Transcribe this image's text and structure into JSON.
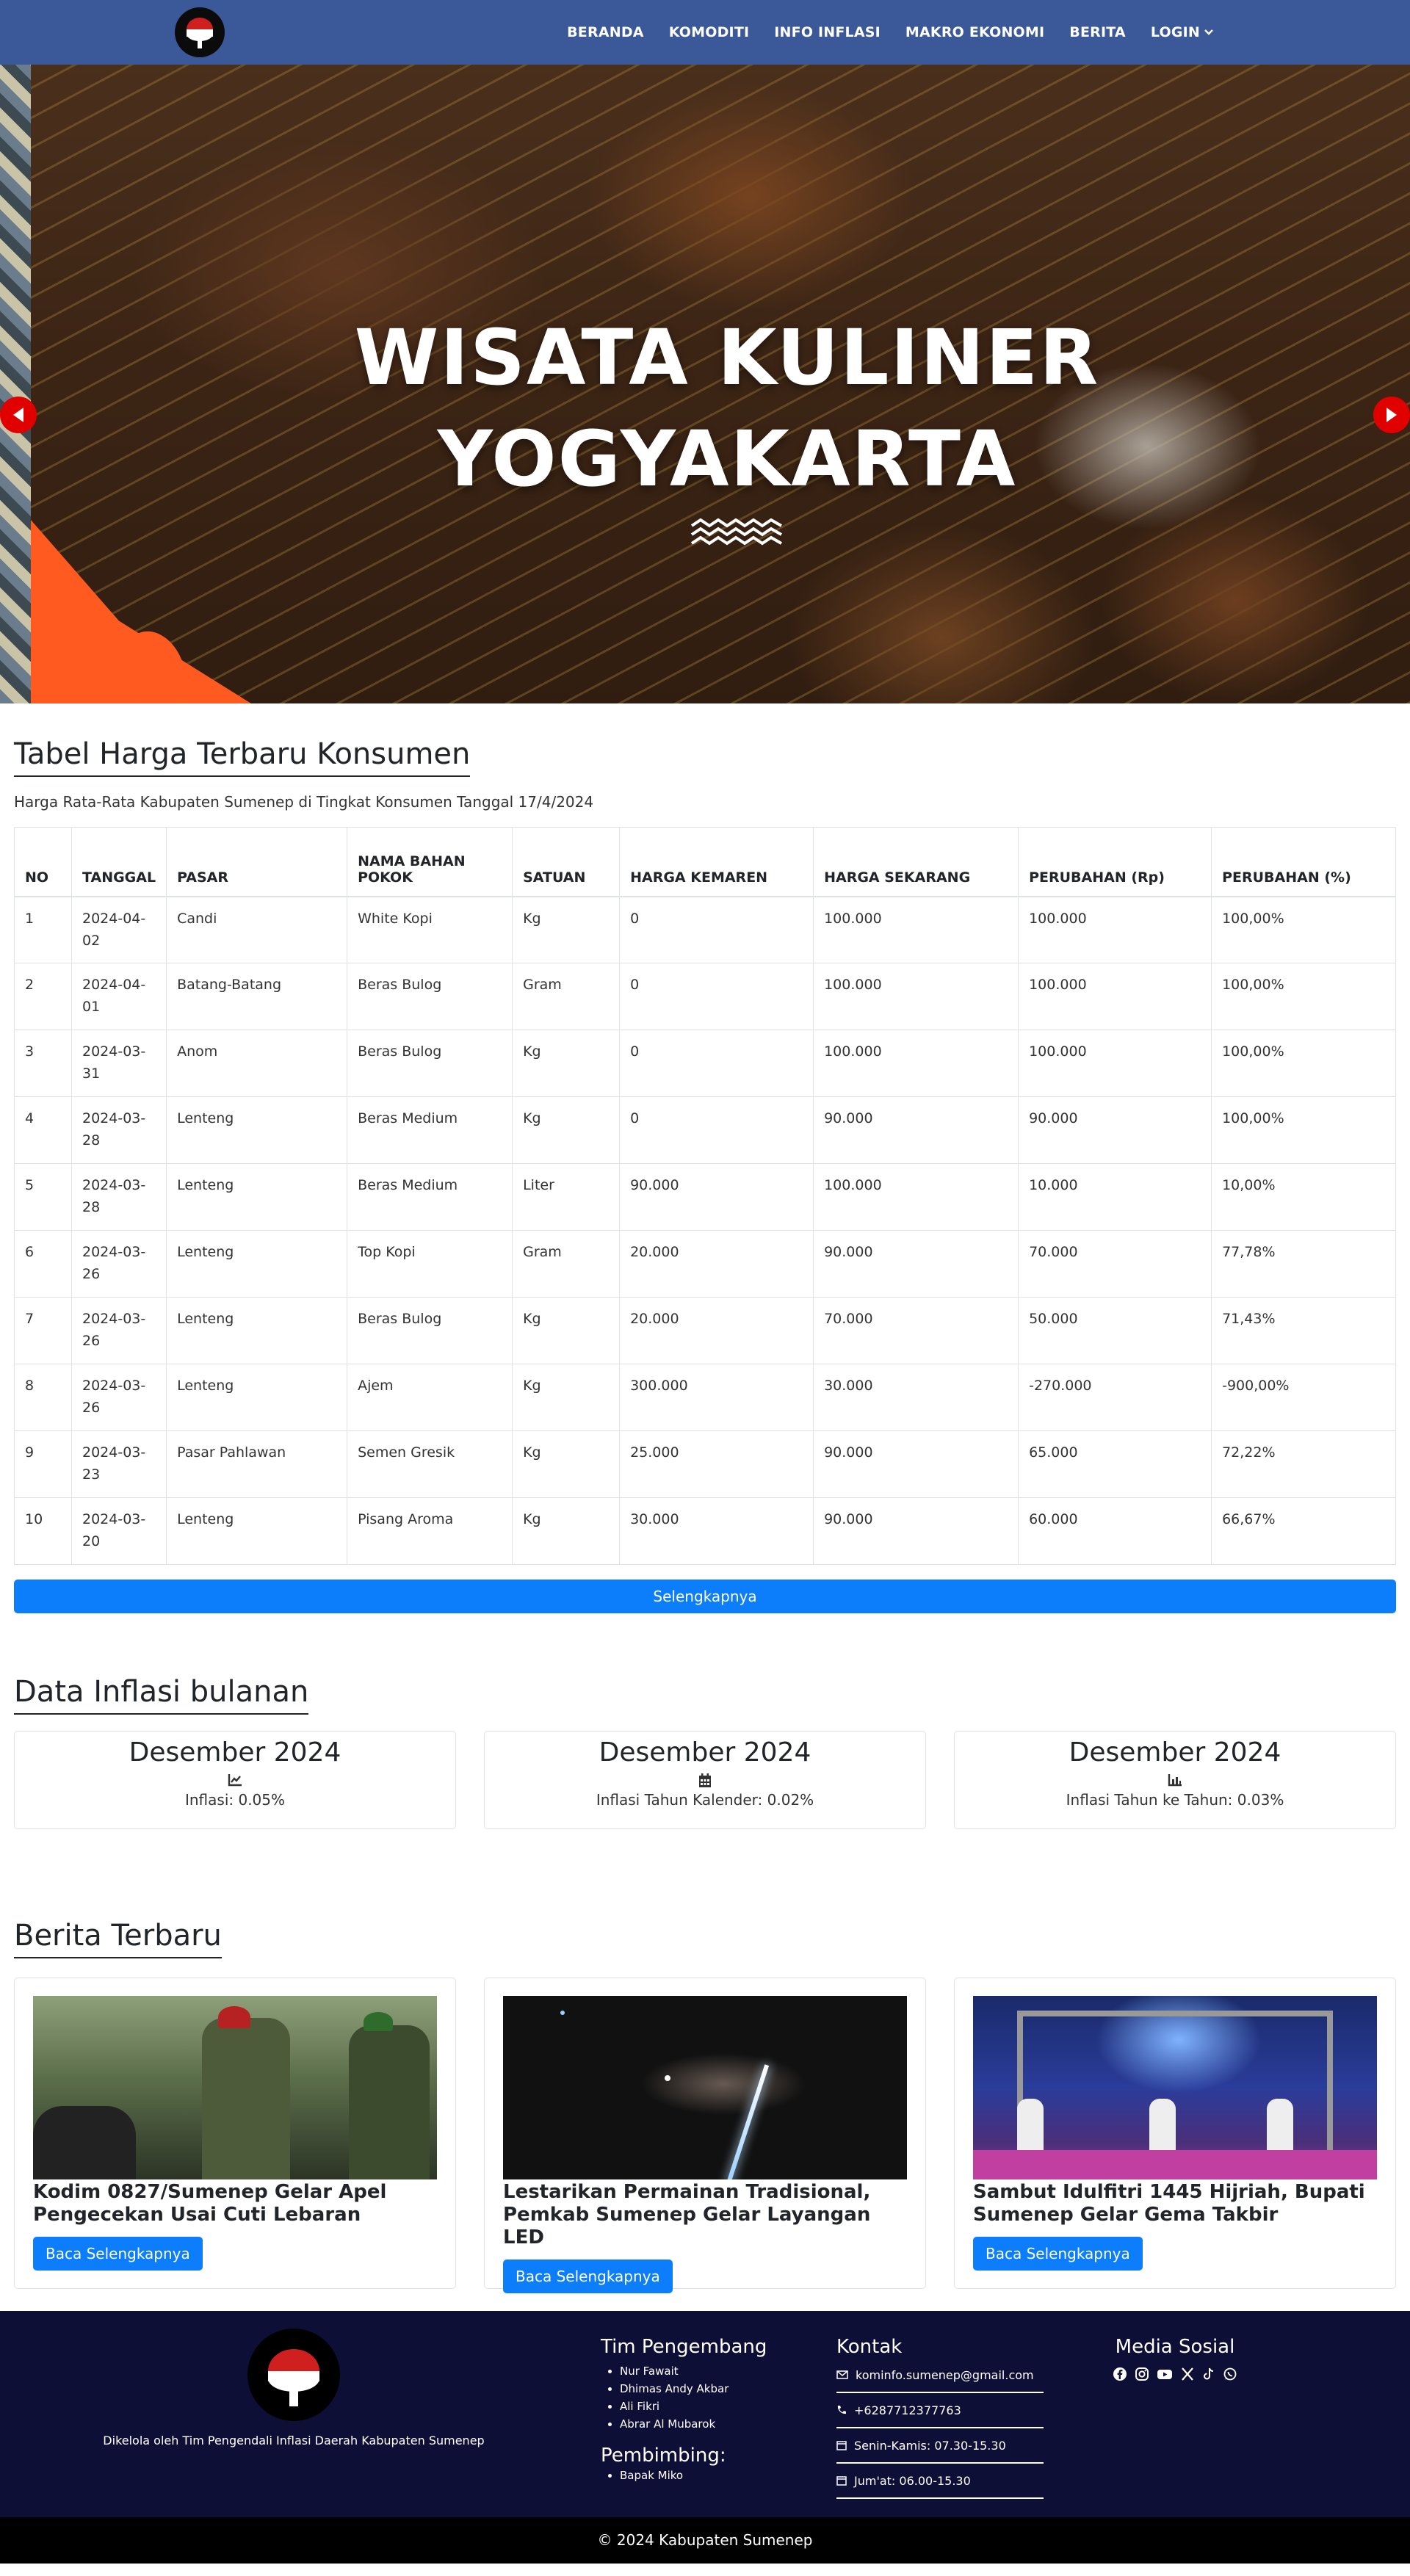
{
  "nav": {
    "items": [
      "BERANDA",
      "KOMODITI",
      "INFO INFLASI",
      "MAKRO EKONOMI",
      "BERITA",
      "LOGIN"
    ]
  },
  "hero": {
    "line1": "WISATA KULINER",
    "line2": "YOGYAKARTA"
  },
  "price_table": {
    "title": "Tabel Harga Terbaru Konsumen",
    "subtitle": "Harga Rata-Rata Kabupaten Sumenep di Tingkat Konsumen Tanggal 17/4/2024",
    "headers": [
      "NO",
      "TANGGAL",
      "PASAR",
      "NAMA BAHAN POKOK",
      "SATUAN",
      "HARGA KEMAREN",
      "HARGA SEKARANG",
      "PERUBAHAN (Rp)",
      "PERUBAHAN (%)"
    ],
    "rows": [
      [
        "1",
        "2024-04-02",
        "Candi",
        "White Kopi",
        "Kg",
        "0",
        "100.000",
        "100.000",
        "100,00%"
      ],
      [
        "2",
        "2024-04-01",
        "Batang-Batang",
        "Beras Bulog",
        "Gram",
        "0",
        "100.000",
        "100.000",
        "100,00%"
      ],
      [
        "3",
        "2024-03-31",
        "Anom",
        "Beras Bulog",
        "Kg",
        "0",
        "100.000",
        "100.000",
        "100,00%"
      ],
      [
        "4",
        "2024-03-28",
        "Lenteng",
        "Beras Medium",
        "Kg",
        "0",
        "90.000",
        "90.000",
        "100,00%"
      ],
      [
        "5",
        "2024-03-28",
        "Lenteng",
        "Beras Medium",
        "Liter",
        "90.000",
        "100.000",
        "10.000",
        "10,00%"
      ],
      [
        "6",
        "2024-03-26",
        "Lenteng",
        "Top Kopi",
        "Gram",
        "20.000",
        "90.000",
        "70.000",
        "77,78%"
      ],
      [
        "7",
        "2024-03-26",
        "Lenteng",
        "Beras Bulog",
        "Kg",
        "20.000",
        "70.000",
        "50.000",
        "71,43%"
      ],
      [
        "8",
        "2024-03-26",
        "Lenteng",
        "Ajem",
        "Kg",
        "300.000",
        "30.000",
        "-270.000",
        "-900,00%"
      ],
      [
        "9",
        "2024-03-23",
        "Pasar Pahlawan",
        "Semen Gresik",
        "Kg",
        "25.000",
        "90.000",
        "65.000",
        "72,22%"
      ],
      [
        "10",
        "2024-03-20",
        "Lenteng",
        "Pisang Aroma",
        "Kg",
        "30.000",
        "90.000",
        "60.000",
        "66,67%"
      ]
    ],
    "more_label": "Selengkapnya"
  },
  "inflasi": {
    "title": "Data Inflasi bulanan",
    "cards": [
      {
        "month": "Desember 2024",
        "icon": "line-chart-icon",
        "text": "Inflasi: 0.05%"
      },
      {
        "month": "Desember 2024",
        "icon": "calendar-icon",
        "text": "Inflasi Tahun Kalender: 0.02%"
      },
      {
        "month": "Desember 2024",
        "icon": "bar-chart-icon",
        "text": "Inflasi Tahun ke Tahun: 0.03%"
      }
    ]
  },
  "berita": {
    "title": "Berita Terbaru",
    "read_label": "Baca Selengkapnya",
    "items": [
      {
        "title": "Kodim 0827/Sumenep Gelar Apel Pengecekan Usai Cuti Lebaran"
      },
      {
        "title": "Lestarikan Permainan Tradisional, Pemkab Sumenep Gelar Layangan LED"
      },
      {
        "title": "Sambut Idulfitri 1445 Hijriah, Bupati Sumenep Gelar Gema Takbir"
      }
    ]
  },
  "footer": {
    "managed_by": "Dikelola oleh Tim Pengendali Inflasi Daerah Kabupaten Sumenep",
    "dev_title": "Tim Pengembang",
    "devs": [
      "Nur Fawait",
      "Dhimas Andy Akbar",
      "Ali Fikri",
      "Abrar Al Mubarok"
    ],
    "pembimbing_title": "Pembimbing:",
    "pembimbing": [
      "Bapak Miko"
    ],
    "kontak_title": "Kontak",
    "kontak": [
      {
        "icon": "mail-icon",
        "text": "kominfo.sumenep@gmail.com"
      },
      {
        "icon": "phone-icon",
        "text": "+6287712377763"
      },
      {
        "icon": "calendar-icon",
        "text": "Senin-Kamis: 07.30-15.30"
      },
      {
        "icon": "calendar-icon",
        "text": "Jum'at: 06.00-15.30"
      }
    ],
    "medsos_title": "Media Sosial",
    "copyright": "© 2024 Kabupaten Sumenep"
  },
  "colors": {
    "navbar": "#3b5998",
    "primary_button": "#0d7efb",
    "footer_bg": "#0e0f37",
    "bottombar_bg": "#000000",
    "hero_arrow": "#e00000"
  }
}
